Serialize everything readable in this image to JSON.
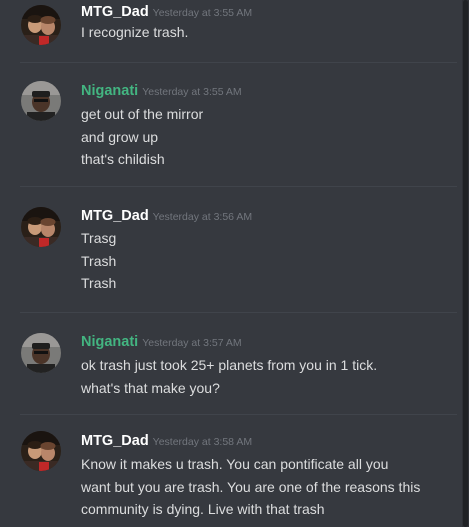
{
  "messages": [
    {
      "author": "MTG_Dad",
      "author_color": "#ffffff",
      "timestamp": "Yesterday at 3:55 AM",
      "avatar": "mtg-dad-avatar",
      "lines": [
        "I recognize trash."
      ]
    },
    {
      "author": "Niganati",
      "author_color": "#43b581",
      "timestamp": "Yesterday at 3:55 AM",
      "avatar": "niganati-avatar",
      "lines": [
        "get out of the mirror",
        "and grow up",
        "that's childish"
      ]
    },
    {
      "author": "MTG_Dad",
      "author_color": "#ffffff",
      "timestamp": "Yesterday at 3:56 AM",
      "avatar": "mtg-dad-avatar",
      "lines": [
        "Trasg",
        "Trash",
        "Trash"
      ]
    },
    {
      "author": "Niganati",
      "author_color": "#43b581",
      "timestamp": "Yesterday at 3:57 AM",
      "avatar": "niganati-avatar",
      "lines": [
        "ok trash just took 25+ planets from you in 1 tick.",
        "what's that make you?"
      ]
    },
    {
      "author": "MTG_Dad",
      "author_color": "#ffffff",
      "timestamp": "Yesterday at 3:58 AM",
      "avatar": "mtg-dad-avatar",
      "lines": [
        "Know it makes u trash.  You can pontificate all you",
        "want but you are trash.  You are one of the reasons this",
        "community is dying.  Live with that trash"
      ]
    }
  ]
}
